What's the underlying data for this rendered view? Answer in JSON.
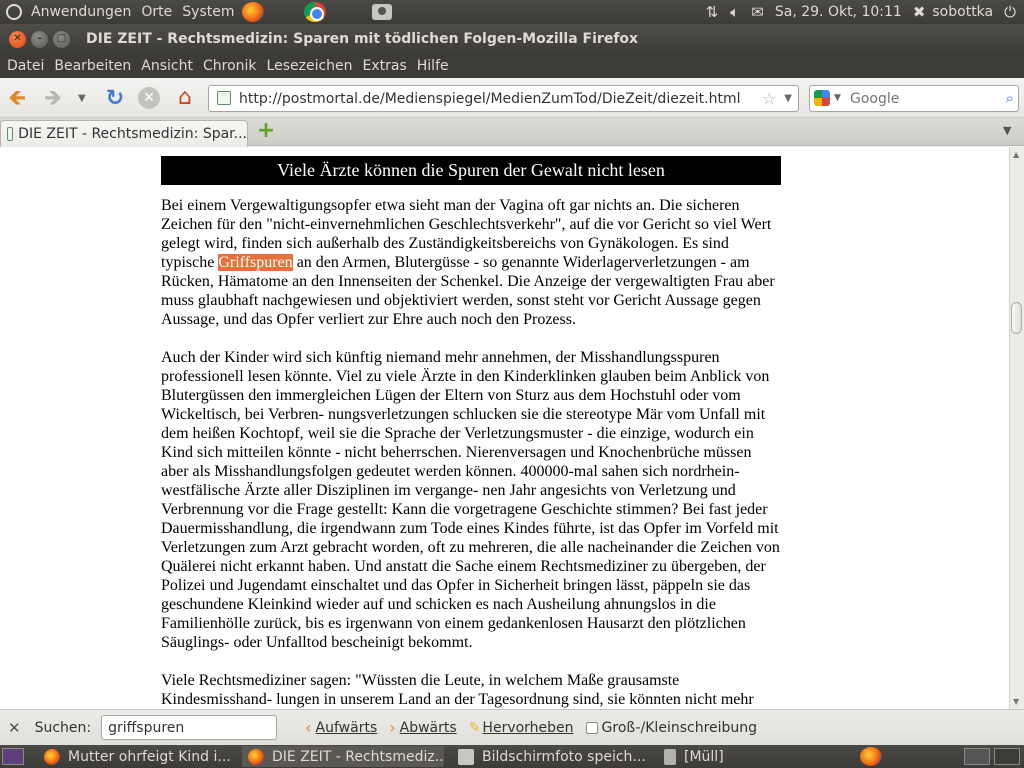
{
  "top_panel": {
    "menu_applications": "Anwendungen",
    "menu_places": "Orte",
    "menu_system": "System",
    "clock": "Sa, 29. Okt, 10:11",
    "user": "sobottka"
  },
  "window": {
    "title": "DIE ZEIT - Rechtsmedizin: Sparen mit tödlichen Folgen-Mozilla Firefox"
  },
  "menubar": {
    "items": [
      "Datei",
      "Bearbeiten",
      "Ansicht",
      "Chronik",
      "Lesezeichen",
      "Extras",
      "Hilfe"
    ]
  },
  "navbar": {
    "url": "http://postmortal.de/Medienspiegel/MedienZumTod/DieZeit/diezeit.html",
    "search_placeholder": "Google"
  },
  "tabs": [
    {
      "label": "DIE ZEIT - Rechtsmedizin: Spar..."
    }
  ],
  "article": {
    "heading": "Viele Ärzte können die Spuren der Gewalt nicht lesen",
    "p1_before": "Bei einem Vergewaltigungsopfer etwa sieht man der Vagina oft gar nichts an. Die sicheren Zeichen für den \"nicht-einvernehmlichen Geschlechtsverkehr\", auf die vor Gericht so viel Wert gelegt wird, finden sich außerhalb des Zuständigkeitsbereichs von Gynäkologen. Es sind typische ",
    "p1_highlight": "Griffspuren",
    "p1_after": " an den Armen, Blutergüsse - so genannte Widerlagerverletzungen - am Rücken, Hämatome an den Innenseiten der Schenkel. Die Anzeige der vergewaltigten Frau aber muss glaubhaft nachgewiesen und objektiviert werden, sonst steht vor Gericht Aussage gegen Aussage, und das Opfer verliert zur Ehre auch noch den Prozess.",
    "p2": "Auch der Kinder wird sich künftig niemand mehr annehmen, der Misshandlungsspuren professionell lesen könnte. Viel zu viele Ärzte in den Kinderklinken glauben beim Anblick von Blutergüssen den immergleichen Lügen der Eltern von Sturz aus dem Hochstuhl oder vom Wickeltisch, bei Verbren- nungsverletzungen schlucken sie die stereotype Mär vom Unfall mit dem heißen Kochtopf, weil sie die Sprache der Verletzungsmuster - die einzige, wodurch ein Kind sich mitteilen könnte - nicht beherrschen. Nierenversagen und Knochenbrüche müssen aber als Misshandlungsfolgen gedeutet werden können. 400000-mal sahen sich nordrhein-westfälische Ärzte aller Disziplinen im vergange- nen Jahr angesichts von Verletzung und Verbrennung vor die Frage gestellt: Kann die vorgetragene Geschichte stimmen? Bei fast jeder Dauermisshandlung, die irgendwann zum Tode eines Kindes führte, ist das Opfer im Vorfeld mit Verletzungen zum Arzt gebracht worden, oft zu mehreren, die alle nacheinander die Zeichen von Quälerei nicht erkannt haben. Und anstatt die Sache einem Rechtsmediziner zu übergeben, der Polizei und Jugendamt einschaltet und das Opfer in Sicherheit bringen lässt, päppeln sie das geschundene Kleinkind wieder auf und schicken es nach Ausheilung ahnungslos in die Familienhölle zurück, bis es irgenwann von einem gedankenlosen Hausarzt den plötzlichen Säuglings- oder Unfalltod bescheinigt bekommt.",
    "p3": "Viele Rechtsmediziner sagen: \"Wüssten die Leute, in welchem Maße grausamste Kindesmisshand- lungen in unserem Land an der Tagesordnung sind, sie könnten nicht mehr schlafen\". Und die Tendenz ist steigend. Die Zahl der zu Kinde misshandelten"
  },
  "findbar": {
    "label": "Suchen:",
    "value": "griffspuren",
    "next": "Aufwärts",
    "prev": "Abwärts",
    "highlight": "Hervorheben",
    "match_case": "Groß-/Kleinschreibung"
  },
  "taskbar": {
    "items": [
      {
        "label": "Mutter ohrfeigt Kind i..."
      },
      {
        "label": "DIE ZEIT - Rechtsmediz..."
      },
      {
        "label": "Bildschirmfoto speich..."
      },
      {
        "label": "[Müll]"
      }
    ]
  },
  "colors": {
    "panel": "#3c3b37",
    "accent_orange": "#e8703a",
    "heading_bg": "#000000"
  }
}
